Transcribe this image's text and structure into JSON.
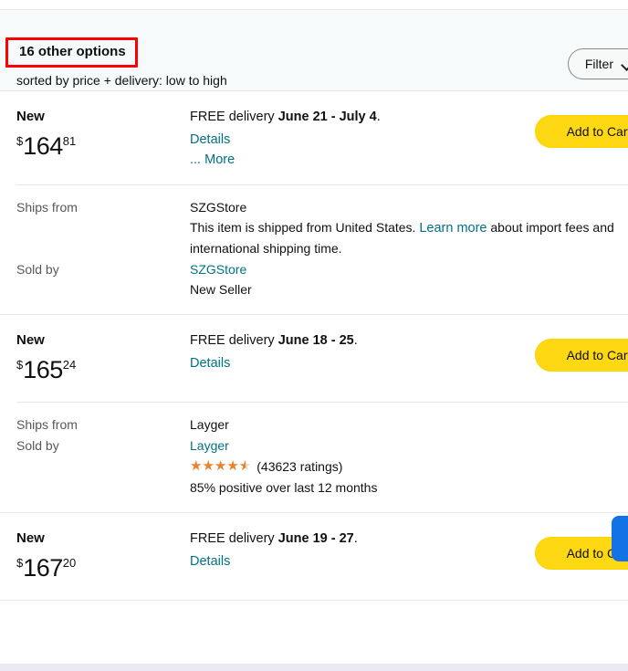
{
  "header": {
    "title": "16 other options",
    "subtitle": "sorted by price + delivery: low to high",
    "filter_label": "Filter",
    "filter_icon": "chevron-down-icon",
    "highlight_color": "#ff0000",
    "background": "#f7fafa"
  },
  "labels": {
    "ships_from": "Ships from",
    "sold_by": "Sold by",
    "add_to_cart": "Add to Cart",
    "details": "Details",
    "more": "... More",
    "learn_more": "Learn more"
  },
  "colors": {
    "link": "#007185",
    "cart_button": "#ffd814",
    "star": "#e8852b",
    "blue_chip": "#1373e6"
  },
  "offers": [
    {
      "condition": "New",
      "price_symbol": "$",
      "price_whole": "164",
      "price_fraction": "81",
      "delivery_prefix": "FREE delivery ",
      "delivery_dates": "June 21 - July 4",
      "delivery_suffix": ".",
      "details_label": "Details",
      "more_label": "... More",
      "add_to_cart": "Add to Cart",
      "ships_from": "SZGStore",
      "import_text_before": "This item is shipped from United States. ",
      "import_link": "Learn more",
      "import_text_after": " about import fees and international shipping time.",
      "sold_by": "SZGStore",
      "seller_status": "New Seller",
      "has_rating": false
    },
    {
      "condition": "New",
      "price_symbol": "$",
      "price_whole": "165",
      "price_fraction": "24",
      "delivery_prefix": "FREE delivery ",
      "delivery_dates": "June 18 - 25",
      "delivery_suffix": ".",
      "details_label": "Details",
      "more_label": "",
      "add_to_cart": "Add to Cart",
      "ships_from": "Layger",
      "sold_by": "Layger",
      "has_rating": true,
      "rating_stars": "4.5",
      "rating_count": "(43623 ratings)",
      "positive_feedback": "85% positive over last 12 months"
    },
    {
      "condition": "New",
      "price_symbol": "$",
      "price_whole": "167",
      "price_fraction": "20",
      "delivery_prefix": "FREE delivery ",
      "delivery_dates": "June 19 - 27",
      "delivery_suffix": ".",
      "details_label": "Details",
      "more_label": "",
      "add_to_cart": "Add to Cart"
    }
  ]
}
